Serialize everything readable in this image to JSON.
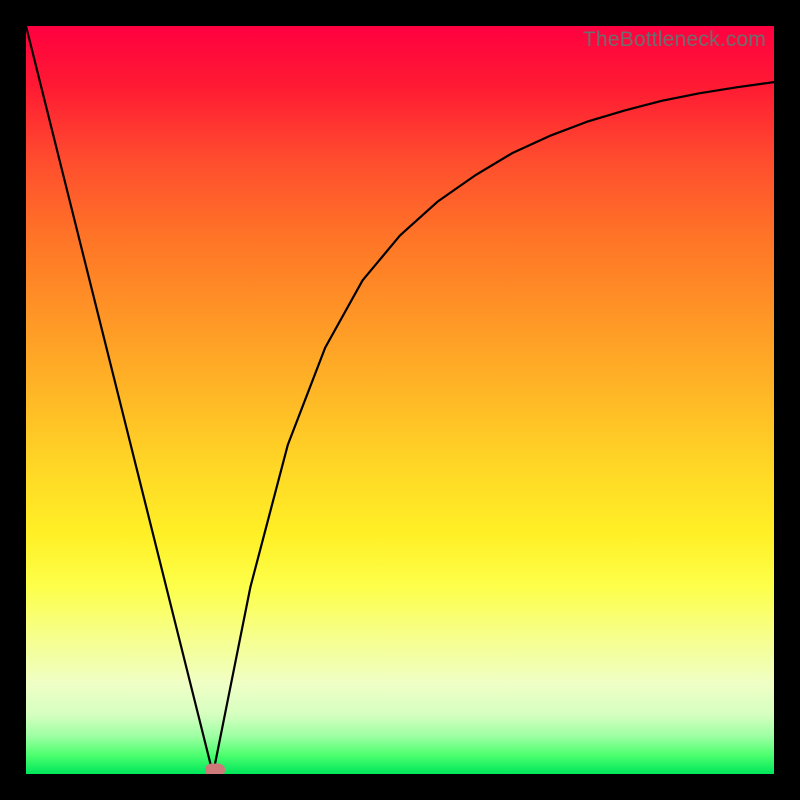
{
  "watermark": "TheBottleneck.com",
  "chart_data": {
    "type": "line",
    "title": "",
    "xlabel": "",
    "ylabel": "",
    "xlim": [
      0,
      100
    ],
    "ylim": [
      0,
      100
    ],
    "grid": false,
    "legend": false,
    "notch_x": 25,
    "series": [
      {
        "name": "bottleneck-curve",
        "x": [
          0,
          5,
          10,
          15,
          20,
          23,
          25,
          27,
          30,
          35,
          40,
          45,
          50,
          55,
          60,
          65,
          70,
          75,
          80,
          85,
          90,
          95,
          100
        ],
        "y": [
          100,
          80,
          60,
          40,
          20,
          8,
          0,
          10,
          25,
          44,
          57,
          66,
          72,
          76.5,
          80,
          83,
          85.3,
          87.2,
          88.7,
          90,
          91,
          91.8,
          92.5
        ]
      }
    ],
    "marker": {
      "x": 25.3,
      "y": 0.5,
      "color": "#cf7a7a"
    },
    "background_gradient": {
      "type": "vertical",
      "stops": [
        {
          "pos": 0.0,
          "color": "#ff0040"
        },
        {
          "pos": 0.38,
          "color": "#ff9326"
        },
        {
          "pos": 0.68,
          "color": "#fff026"
        },
        {
          "pos": 0.88,
          "color": "#efffc6"
        },
        {
          "pos": 1.0,
          "color": "#00e65c"
        }
      ]
    }
  }
}
